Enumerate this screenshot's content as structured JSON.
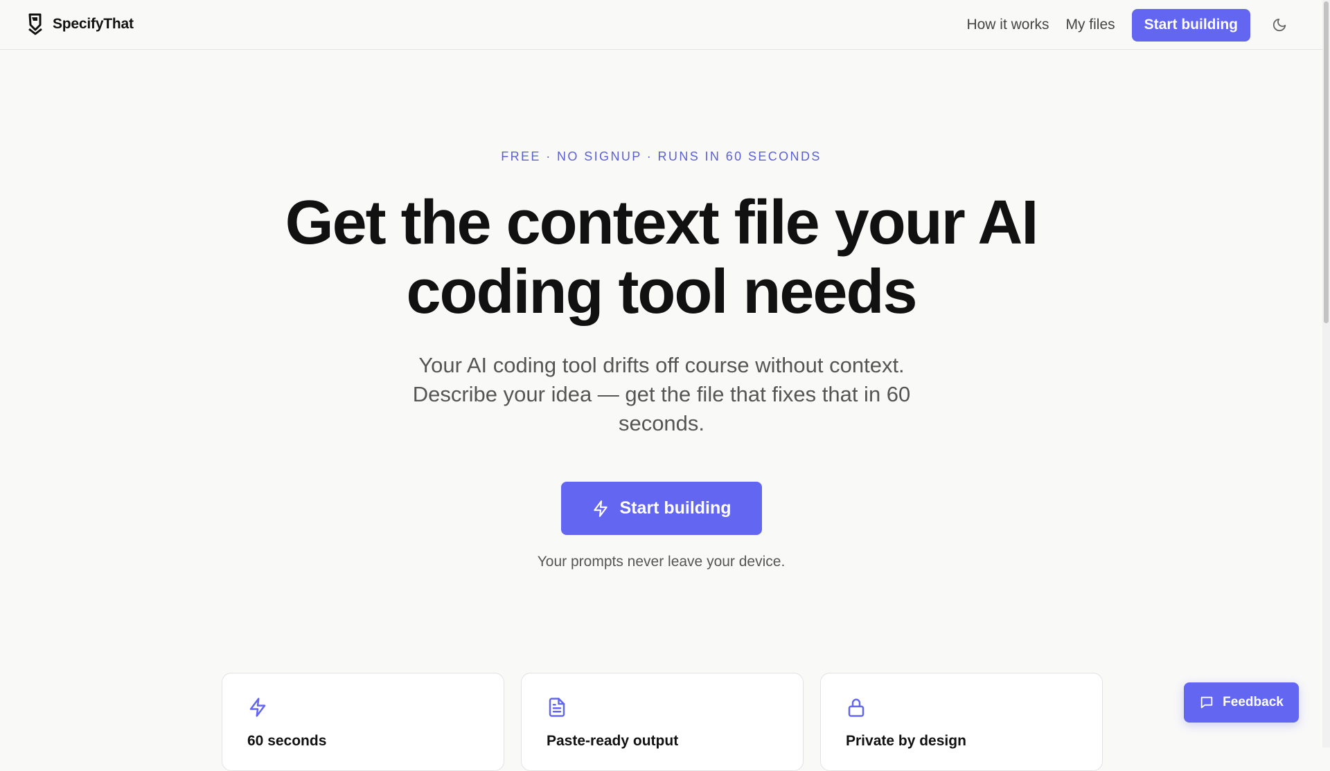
{
  "colors": {
    "accent": "#6366f1",
    "eyebrow": "#5b5fd6",
    "background": "#f9f9f8"
  },
  "header": {
    "brand": "SpecifyThat",
    "logo_icon": "specifythat-logo-icon",
    "nav": {
      "how_it_works": "How it works",
      "my_files": "My files",
      "start_building": "Start building"
    },
    "theme_toggle_icon": "moon-icon"
  },
  "hero": {
    "eyebrow": "FREE · NO SIGNUP · RUNS IN 60 SECONDS",
    "title_line1": "Get the context file your AI",
    "title_line2": "coding tool needs",
    "subtitle": "Your AI coding tool drifts off course without context. Describe your idea — get the file that fixes that in 60 seconds.",
    "cta_label": "Start building",
    "cta_icon": "lightning-icon",
    "privacy_note": "Your prompts never leave your device."
  },
  "features": [
    {
      "icon": "lightning-icon",
      "title": "60 seconds"
    },
    {
      "icon": "document-icon",
      "title": "Paste-ready output"
    },
    {
      "icon": "lock-icon",
      "title": "Private by design"
    }
  ],
  "feedback": {
    "label": "Feedback",
    "icon": "chat-icon"
  }
}
